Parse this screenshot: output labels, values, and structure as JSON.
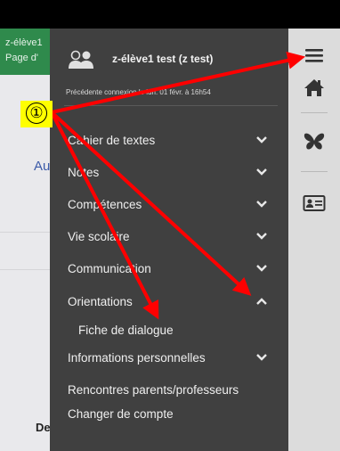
{
  "background_page": {
    "header_line1": "z-élève1",
    "header_line2": "Page d'",
    "fragment_au": "Au",
    "fragment_dem": "Dem"
  },
  "drawer": {
    "username": "z-élève1 test (z test)",
    "last_connection": "Précédente connexion le lun. 01 févr. à 16h54",
    "menu": [
      {
        "label": "Cahier de textes",
        "expanded": false
      },
      {
        "label": "Notes",
        "expanded": false
      },
      {
        "label": "Compétences",
        "expanded": false
      },
      {
        "label": "Vie scolaire",
        "expanded": false
      },
      {
        "label": "Communication",
        "expanded": false
      },
      {
        "label": "Orientations",
        "expanded": true
      },
      {
        "label": "Fiche de dialogue"
      },
      {
        "label": "Informations personnelles",
        "expanded": false
      },
      {
        "label": "Rencontres parents/professeurs"
      },
      {
        "label": "Changer de compte"
      }
    ]
  },
  "rail": {
    "icons": [
      "hamburger-menu-icon",
      "home-icon",
      "butterfly-icon",
      "id-card-icon"
    ]
  },
  "annotation": {
    "marker_label": "①",
    "marker_color": "#ffff00",
    "arrow_color": "#ff0000"
  },
  "colors": {
    "drawer_bg": "#404040",
    "rail_bg": "#dcdcdc",
    "header_green": "#2f8a4c"
  }
}
